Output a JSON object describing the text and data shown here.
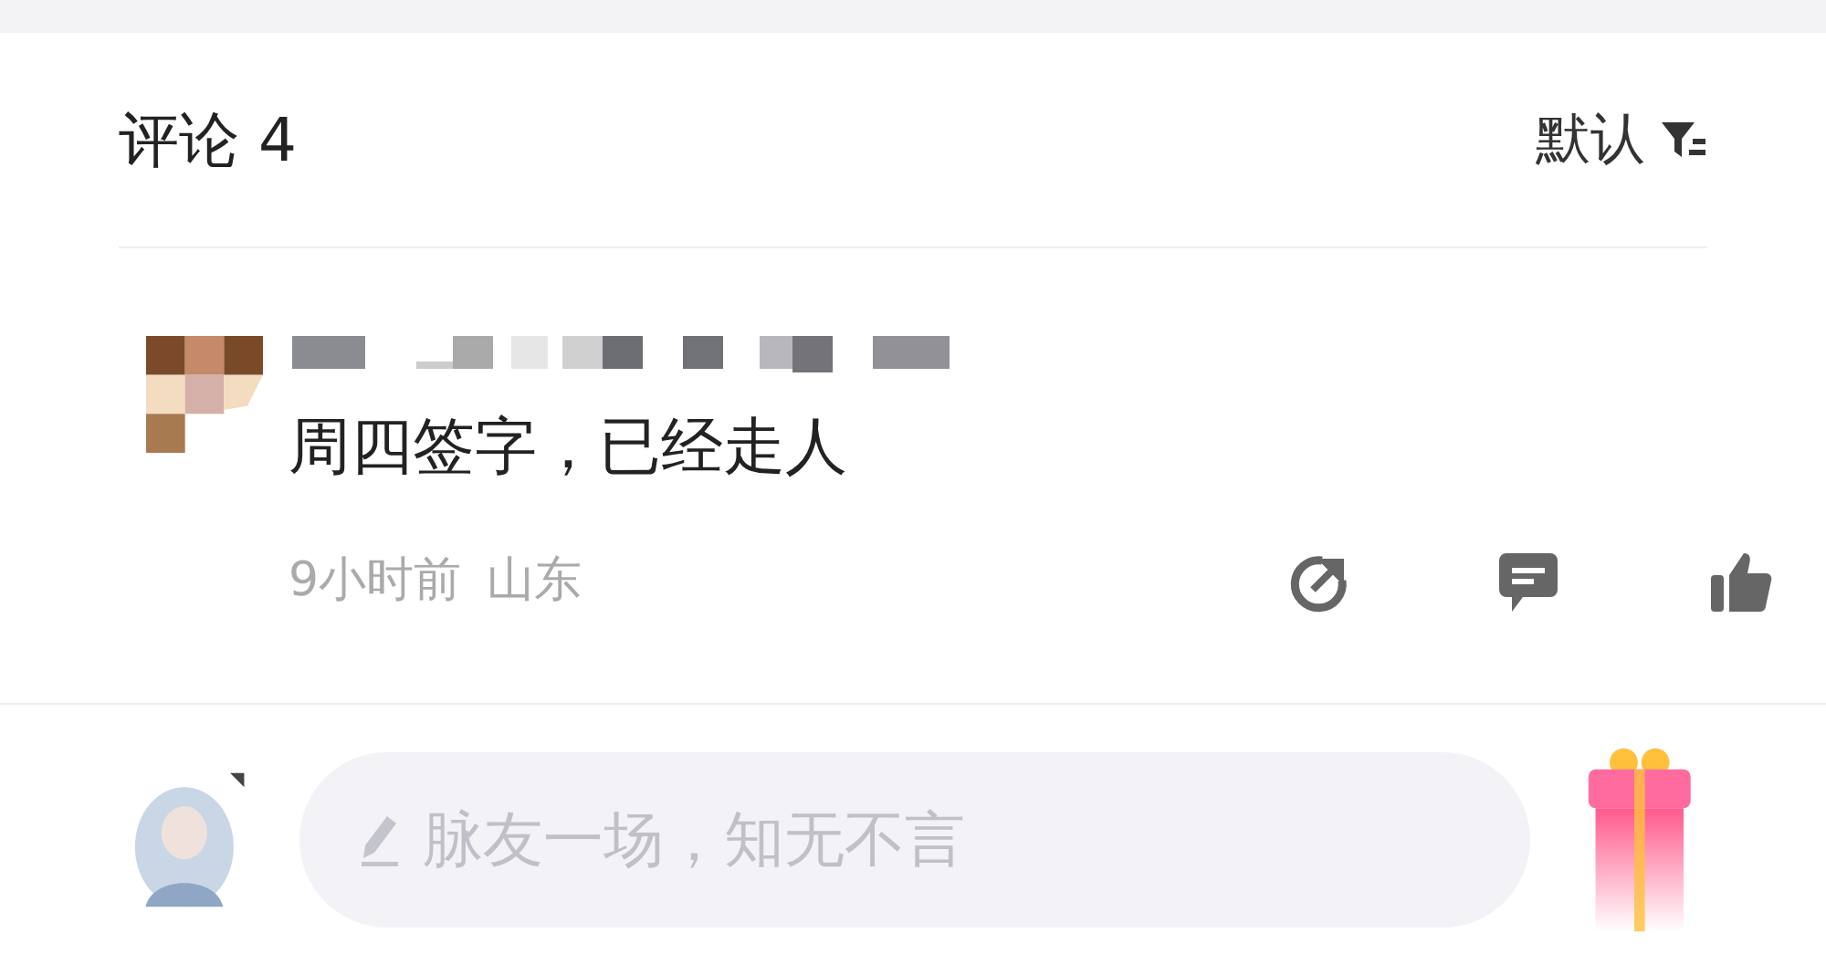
{
  "comments_header": {
    "title": "评论 4",
    "sort": "默认"
  },
  "comments": [
    {
      "text": "周四签字，已经走人",
      "time": "9小时前",
      "location": "山东"
    }
  ],
  "composer": {
    "placeholder": "脉友一场，知无不言"
  }
}
